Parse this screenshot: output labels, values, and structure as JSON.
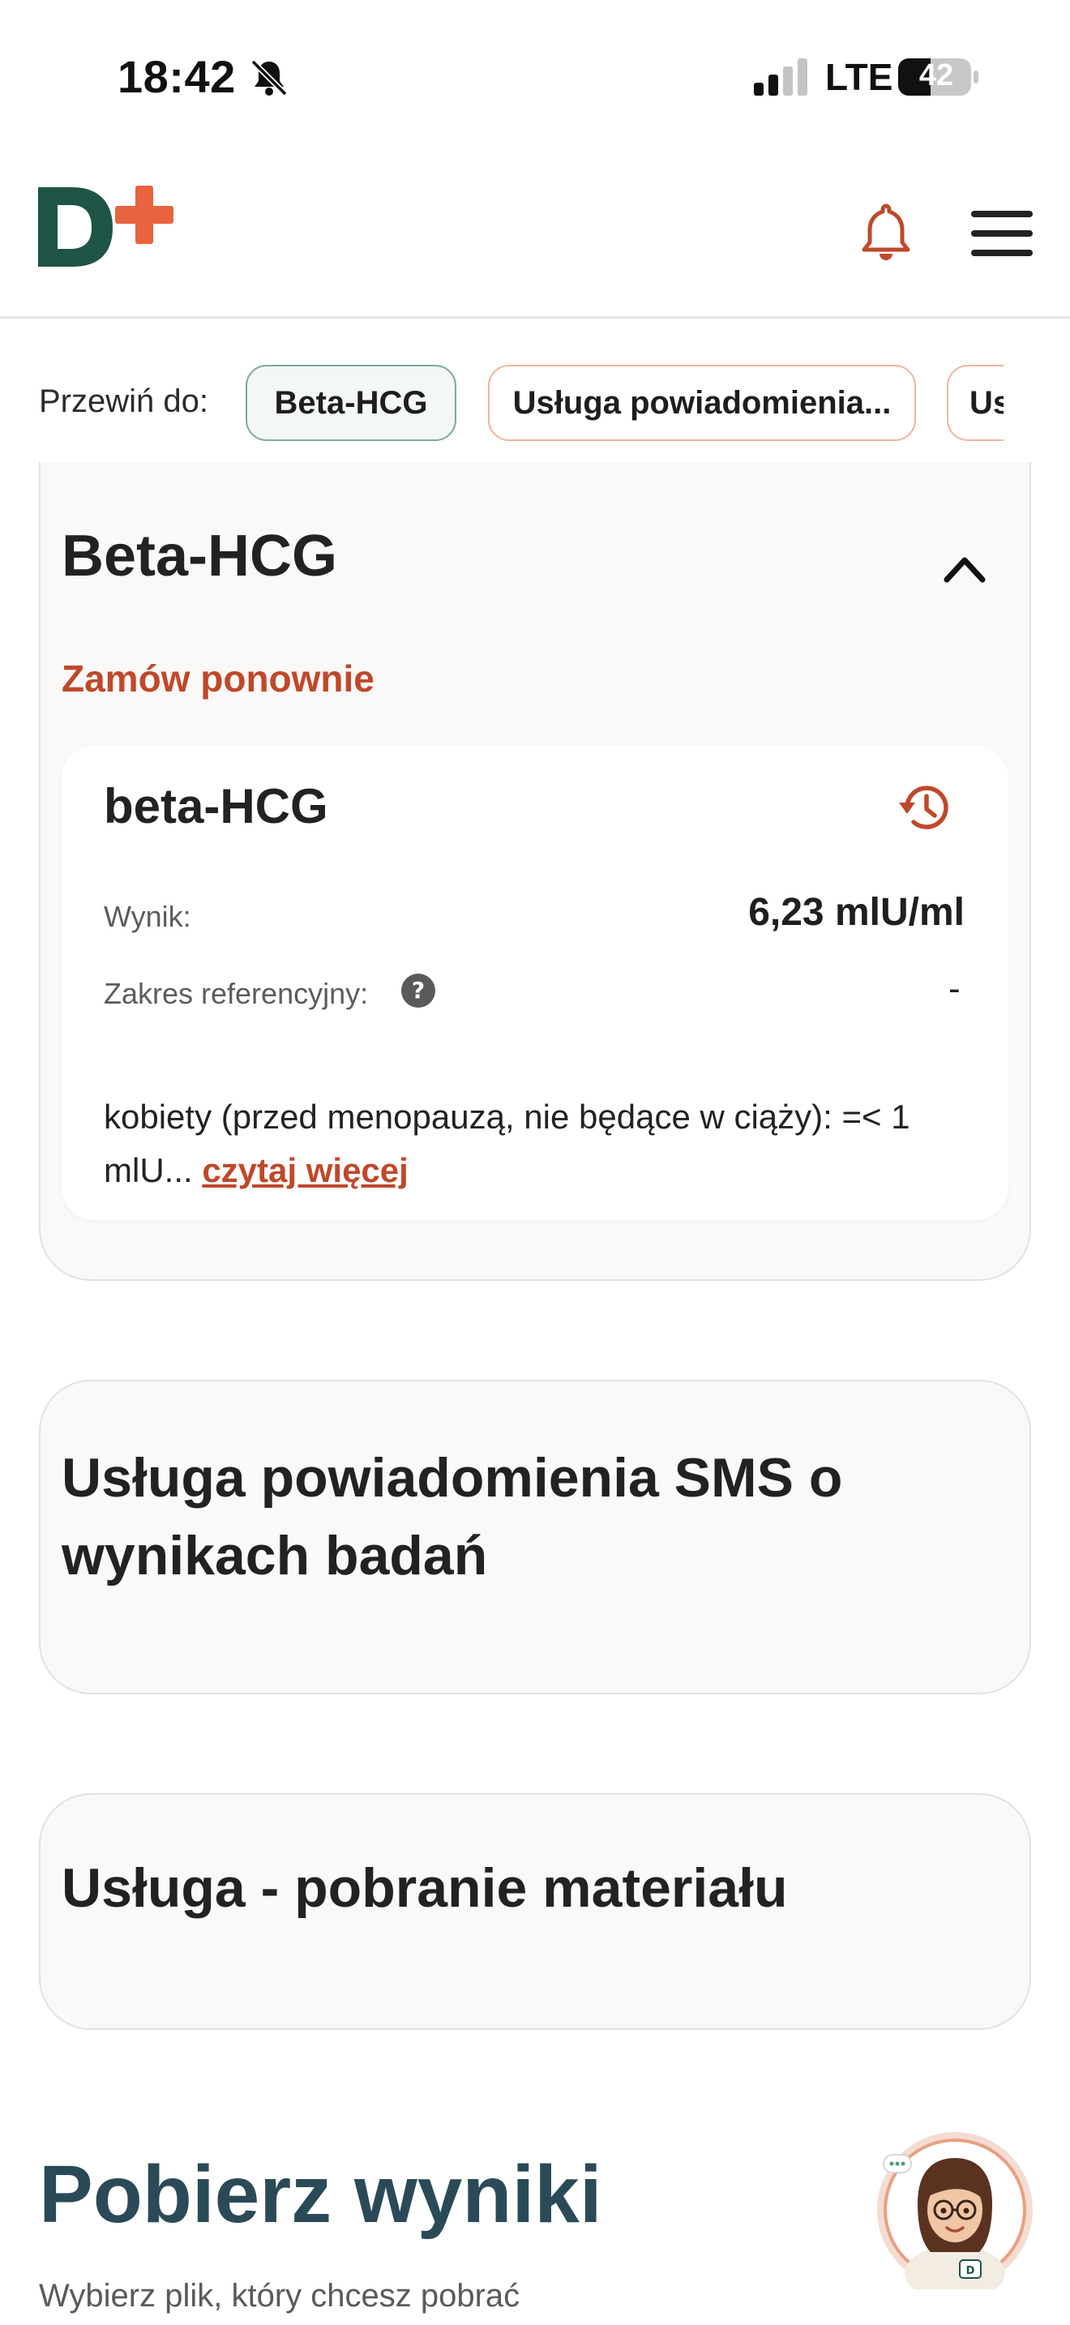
{
  "status_bar": {
    "time": "18:42",
    "network": "LTE",
    "battery": "42"
  },
  "header": {
    "logo_text": "D+",
    "icons": [
      "bell-icon",
      "hamburger-menu-icon"
    ]
  },
  "scroll_to": {
    "label": "Przewiń do:",
    "chips": [
      "Beta-HCG",
      "Usługa powiadomienia...",
      "Us"
    ]
  },
  "sections": [
    {
      "title": "Beta-HCG",
      "reorder_label": "Zamów ponownie",
      "test": {
        "name": "beta-HCG",
        "result_label": "Wynik:",
        "result_value": "6,23 mlU/ml",
        "range_label": "Zakres referencyjny:",
        "range_value": "-",
        "description": "kobiety (przed menopauzą, nie będące w ciąży): =< 1 mlU...",
        "read_more": "czytaj więcej"
      }
    },
    {
      "title": "Usługa powiadomienia SMS o wynikach badań"
    },
    {
      "title": "Usługa - pobranie materiału"
    }
  ],
  "download": {
    "title": "Pobierz wyniki",
    "subtitle": "Wybierz plik, który chcesz pobrać"
  },
  "colors": {
    "brand_green": "#1f5546",
    "brand_orange": "#e8643f",
    "accent_text": "#c0482a",
    "heading_dark_teal": "#2b4a57"
  }
}
